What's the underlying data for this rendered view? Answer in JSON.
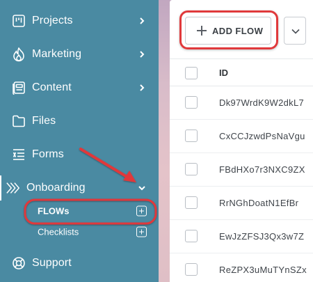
{
  "sidebar": {
    "items": [
      {
        "label": "Projects",
        "icon": "projects-icon",
        "expandable": true
      },
      {
        "label": "Marketing",
        "icon": "flame-icon",
        "expandable": true
      },
      {
        "label": "Content",
        "icon": "content-icon",
        "expandable": true
      },
      {
        "label": "Files",
        "icon": "folder-icon",
        "expandable": false
      },
      {
        "label": "Forms",
        "icon": "forms-icon",
        "expandable": false
      },
      {
        "label": "Onboarding",
        "icon": "onboarding-icon",
        "expandable": true,
        "expanded": true,
        "children": [
          {
            "label": "FLOWs",
            "action_icon": "add-box-icon"
          },
          {
            "label": "Checklists",
            "action_icon": "add-box-icon"
          }
        ]
      },
      {
        "label": "Support",
        "icon": "support-icon",
        "expandable": false
      }
    ]
  },
  "toolbar": {
    "add_flow_label": "ADD FLOW",
    "dropdown_icon": "chevron-down-icon"
  },
  "table": {
    "columns": [
      "ID"
    ],
    "rows": [
      {
        "id": "Dk97WrdK9W2dkL7"
      },
      {
        "id": "CxCCJzwdPsNaVgu"
      },
      {
        "id": "FBdHXo7r3NXC9ZX"
      },
      {
        "id": "RrNGhDoatN1EfBr"
      },
      {
        "id": "EwJzZFSJ3Qx3w7Z"
      },
      {
        "id": "ReZPX3uMuTYnSZx"
      }
    ]
  },
  "colors": {
    "sidebar_bg": "#4a8aa2",
    "annotation_red": "#e0393b"
  }
}
